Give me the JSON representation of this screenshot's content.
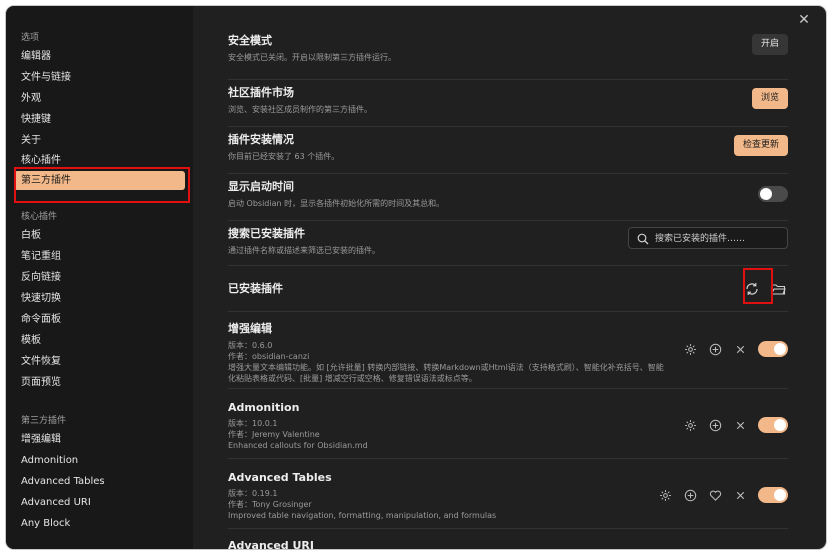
{
  "sidebar": {
    "options_header": "选项",
    "options": [
      "编辑器",
      "文件与链接",
      "外观",
      "快捷键",
      "关于",
      "核心插件",
      "第三方插件"
    ],
    "active_index": 6,
    "core_header": "核心插件",
    "core": [
      "白板",
      "笔记重组",
      "反向链接",
      "快速切换",
      "命令面板",
      "模板",
      "文件恢复",
      "页面预览"
    ],
    "third_header": "第三方插件",
    "third": [
      "增强编辑",
      "Admonition",
      "Advanced Tables",
      "Advanced URI",
      "Any Block"
    ]
  },
  "settings": {
    "safe_mode": {
      "title": "安全模式",
      "desc": "安全模式已关闭。开启以限制第三方插件运行。",
      "button": "开启"
    },
    "market": {
      "title": "社区插件市场",
      "desc": "浏览、安装社区成员制作的第三方插件。",
      "button": "浏览"
    },
    "install_status": {
      "title": "插件安装情况",
      "desc": "你目前已经安装了 63 个插件。",
      "button": "检查更新"
    },
    "startup_time": {
      "title": "显示启动时间",
      "desc": "启动 Obsidian 时，显示各插件初始化所需的时间及其总和。",
      "toggle_on": false
    },
    "search": {
      "title": "搜索已安装插件",
      "desc": "通过插件名称或描述来筛选已安装的插件。",
      "placeholder": "搜索已安装的插件……"
    },
    "installed_header": "已安装插件"
  },
  "plugins": [
    {
      "name": "增强编辑",
      "version": "版本：0.6.0",
      "author": "作者：obsidian-canzi",
      "desc": "增强大量文本编辑功能。如 [允许批量] 转换内部链接、转换Markdown或Html语法（支持格式刷）、智能化补充括号、智能化粘贴表格或代码、[批量] 增减空行或空格、修复错误语法或标点等。",
      "enabled": true
    },
    {
      "name": "Admonition",
      "version": "版本：10.0.1",
      "author": "作者：Jeremy Valentine",
      "desc": "Enhanced callouts for Obsidian.md",
      "enabled": true
    },
    {
      "name": "Advanced Tables",
      "version": "版本：0.19.1",
      "author": "作者：Tony Grosinger",
      "desc": "Improved table navigation, formatting, manipulation, and formulas",
      "enabled": true,
      "has_donate": true
    },
    {
      "name": "Advanced URI",
      "version": "",
      "author": "",
      "desc": "",
      "enabled": true
    }
  ],
  "colors": {
    "accent": "#f2b889",
    "highlight": "#e01010",
    "background": "#202020",
    "sidebar": "#181818"
  },
  "icons": [
    "close-icon",
    "search-icon",
    "refresh-icon",
    "folder-icon",
    "gear-icon",
    "plus-circle-icon",
    "heart-icon",
    "x-icon"
  ]
}
